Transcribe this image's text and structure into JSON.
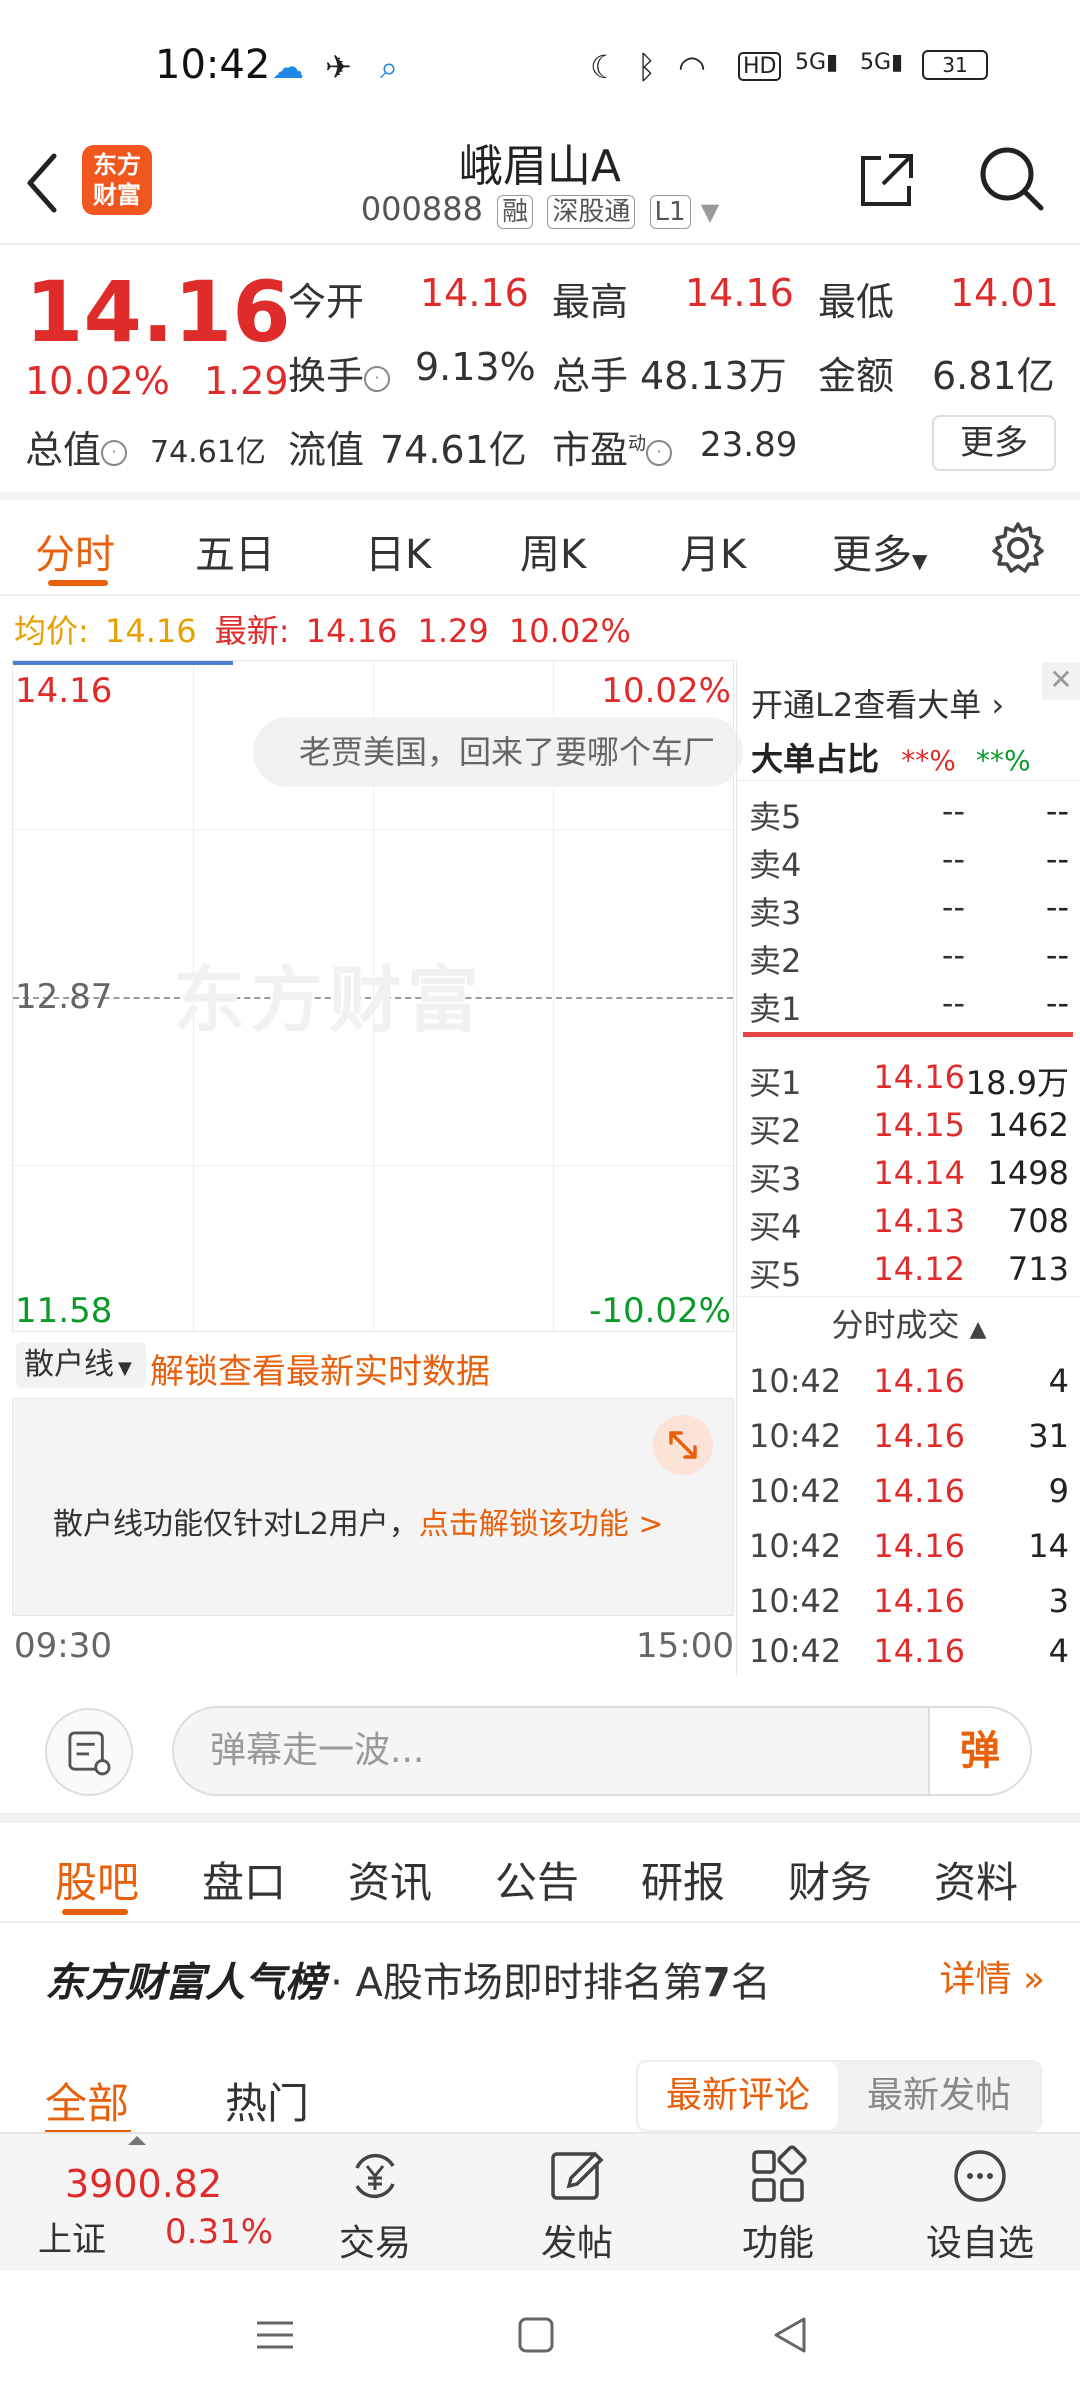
{
  "status": {
    "time": "10:42",
    "battery": "31"
  },
  "header": {
    "logo_line1": "东方",
    "logo_line2": "财富",
    "name": "峨眉山A",
    "code": "000888",
    "tags": [
      "融",
      "深股通",
      "L1"
    ]
  },
  "quote": {
    "price": "14.16",
    "change_pct": "10.02%",
    "change": "1.29",
    "rows": [
      [
        {
          "label": "今开",
          "value": "14.16"
        },
        {
          "label": "最高",
          "value": "14.16"
        },
        {
          "label": "最低",
          "value": "14.01"
        }
      ],
      [
        {
          "label": "换手",
          "value": "9.13%"
        },
        {
          "label": "总手",
          "value": "48.13万"
        },
        {
          "label": "金额",
          "value": "6.81亿"
        }
      ]
    ],
    "total_value_label": "总值",
    "total_value": "74.61亿",
    "float_value_label": "流值",
    "float_value": "74.61亿",
    "pe_label": "市盈",
    "pe_sup": "动",
    "pe_value": "23.89",
    "more": "更多"
  },
  "time_tabs": [
    "分时",
    "五日",
    "日K",
    "周K",
    "月K",
    "更多"
  ],
  "avg_row": {
    "avg_label": "均价:",
    "avg_value": "14.16",
    "latest_label": "最新:",
    "latest_value": "14.16",
    "latest_change": "1.29",
    "latest_pct": "10.02%"
  },
  "chart": {
    "top_price": "14.16",
    "top_pct": "10.02%",
    "mid_price": "12.87",
    "bottom_price": "11.58",
    "bottom_pct": "-10.02%",
    "watermark": "东方财富",
    "bubble": "老贾美国，回来了要哪个车厂",
    "time_start": "09:30",
    "time_end": "15:00"
  },
  "orderbook": {
    "l2_link": "开通L2查看大单",
    "big_ratio_label": "大单占比",
    "big_ratio_red": "**%",
    "big_ratio_green": "**%",
    "sells": [
      {
        "label": "卖5",
        "price": "--",
        "vol": "--"
      },
      {
        "label": "卖4",
        "price": "--",
        "vol": "--"
      },
      {
        "label": "卖3",
        "price": "--",
        "vol": "--"
      },
      {
        "label": "卖2",
        "price": "--",
        "vol": "--"
      },
      {
        "label": "卖1",
        "price": "--",
        "vol": "--"
      }
    ],
    "buys": [
      {
        "label": "买1",
        "price": "14.16",
        "vol": "18.9万"
      },
      {
        "label": "买2",
        "price": "14.15",
        "vol": "1462"
      },
      {
        "label": "买3",
        "price": "14.14",
        "vol": "1498"
      },
      {
        "label": "买4",
        "price": "14.13",
        "vol": "708"
      },
      {
        "label": "买5",
        "price": "14.12",
        "vol": "713"
      }
    ],
    "ticks_title": "分时成交",
    "ticks": [
      {
        "time": "10:42",
        "price": "14.16",
        "vol": "4"
      },
      {
        "time": "10:42",
        "price": "14.16",
        "vol": "31"
      },
      {
        "time": "10:42",
        "price": "14.16",
        "vol": "9"
      },
      {
        "time": "10:42",
        "price": "14.16",
        "vol": "14"
      },
      {
        "time": "10:42",
        "price": "14.16",
        "vol": "3"
      },
      {
        "time": "10:42",
        "price": "14.16",
        "vol": "4"
      }
    ]
  },
  "scatter": {
    "selector": "散户线",
    "unlock": "解锁查看最新实时数据",
    "msg": "散户线功能仅针对L2用户，",
    "msg_link": "点击解锁该功能 >"
  },
  "danmu": {
    "placeholder": "弹幕走一波...",
    "button": "弹"
  },
  "bottom_tabs": [
    "股吧",
    "盘口",
    "资讯",
    "公告",
    "研报",
    "财务",
    "资料"
  ],
  "rank": {
    "brand": "东方财富人气榜",
    "text_prefix": "· A股市场即时排名第",
    "rank": "7",
    "text_suffix": "名",
    "detail": "详情"
  },
  "filters": {
    "all": "全部",
    "hot": "热门",
    "seg_a": "最新评论",
    "seg_b": "最新发帖"
  },
  "bottom_bar": {
    "index_value": "3900.82",
    "index_name": "上证",
    "index_change": "0.31%",
    "items": [
      "交易",
      "发帖",
      "功能",
      "设自选"
    ]
  },
  "colors": {
    "accent": "#e8600c",
    "up": "#e02b2b",
    "down": "#0a9a2a"
  }
}
